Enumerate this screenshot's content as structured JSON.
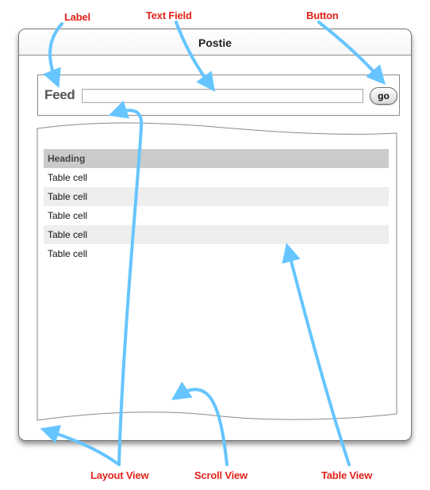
{
  "callouts": {
    "label": "Label",
    "text_field": "Text Field",
    "button": "Button",
    "layout_view": "Layout View",
    "scroll_view": "Scroll View",
    "table_view": "Table View"
  },
  "window": {
    "title": "Postie"
  },
  "toolbar": {
    "feed_label": "Feed",
    "input_value": "",
    "go_label": "go"
  },
  "table": {
    "heading": "Heading",
    "rows": [
      "Table cell",
      "Table cell",
      "Table cell",
      "Table cell",
      "Table cell"
    ]
  },
  "colors": {
    "callout": "#e2231a",
    "arrow": "#66c5ff",
    "heading_bg": "#cbcbcb",
    "alt_row_bg": "#eeeeee"
  }
}
